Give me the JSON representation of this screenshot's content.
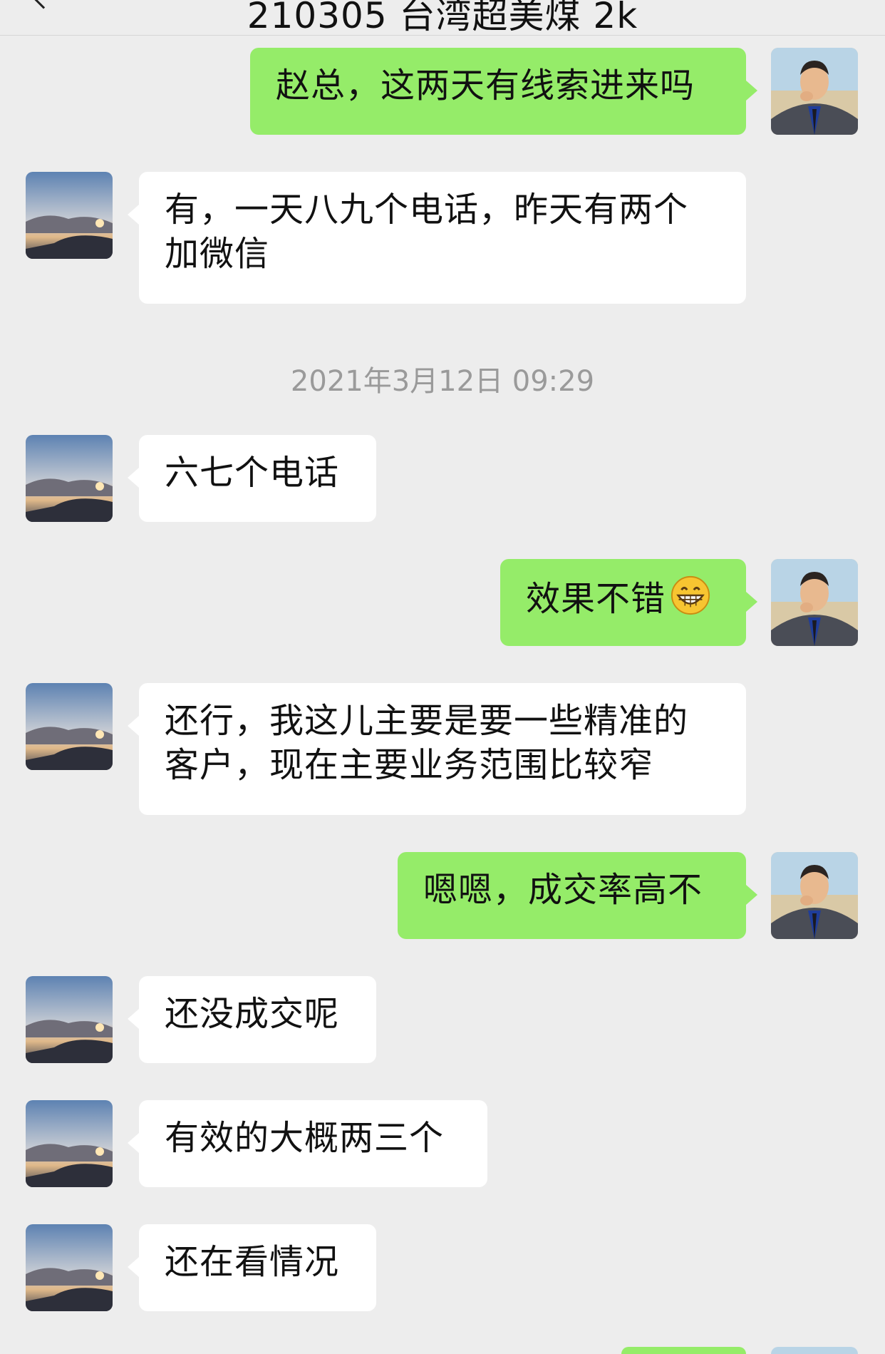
{
  "header": {
    "title": "210305 台湾超美煤 2k"
  },
  "timestamp": "2021年3月12日 09:29",
  "messages": [
    {
      "side": "out",
      "text": "赵总，这两天有线索进来吗"
    },
    {
      "side": "in",
      "text": "有，一天八九个电话，昨天有两个加微信"
    },
    {
      "side": "in",
      "text": "六七个电话"
    },
    {
      "side": "out",
      "text": "效果不错",
      "emoji": "grinning-face-icon"
    },
    {
      "side": "in",
      "text": "还行，我这儿主要是要一些精准的客户，现在主要业务范围比较窄"
    },
    {
      "side": "out",
      "text": "嗯嗯，成交率高不"
    },
    {
      "side": "in",
      "text": "还没成交呢"
    },
    {
      "side": "in",
      "text": "有效的大概两三个"
    },
    {
      "side": "in",
      "text": "还在看情况"
    }
  ],
  "colors": {
    "outgoing_bubble": "#95ec69",
    "incoming_bubble": "#ffffff",
    "background": "#ededed"
  }
}
